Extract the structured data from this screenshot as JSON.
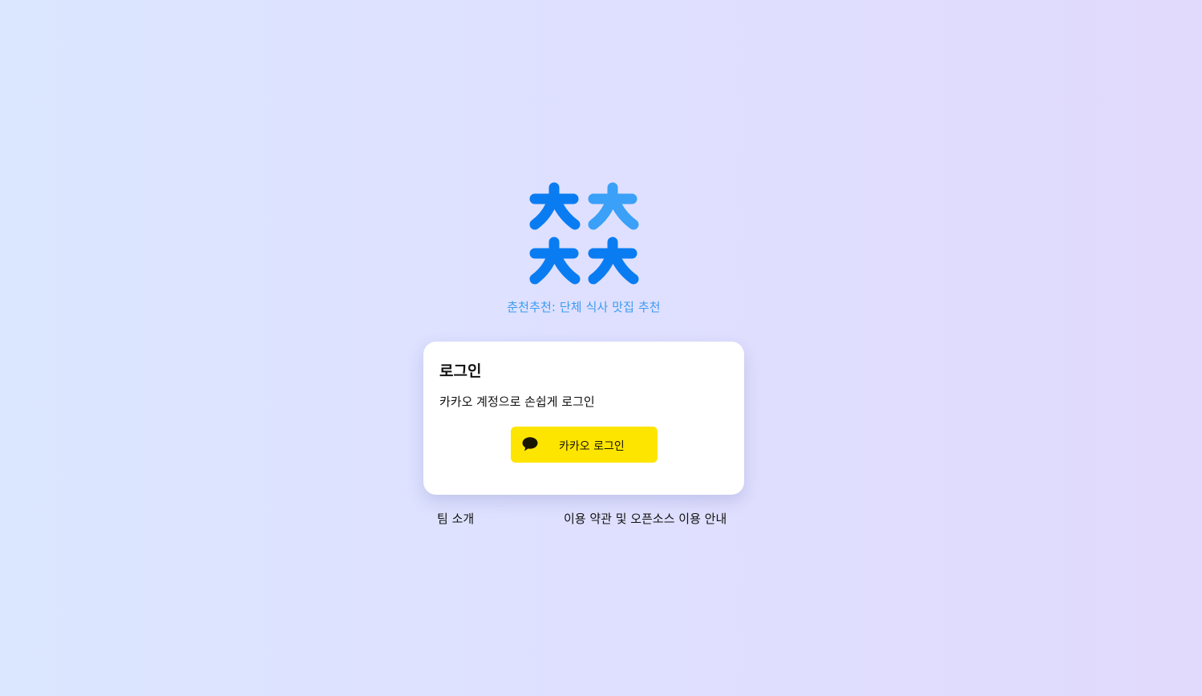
{
  "logo": {
    "icon": "chuncheon-logo-icon",
    "colors": {
      "primary": "#0a7cf2",
      "accent": "#3aa0f8"
    }
  },
  "tagline": "춘천추천: 단체 식사 맛집 추천",
  "login_card": {
    "title": "로그인",
    "description": "카카오 계정으로 손쉽게 로그인",
    "kakao_button": {
      "label": "카카오 로그인",
      "icon": "speech-bubble-icon",
      "background": "#fee500"
    }
  },
  "footer": {
    "team_link": "팀 소개",
    "terms_link": "이용 약관 및 오픈소스 이용 안내"
  }
}
